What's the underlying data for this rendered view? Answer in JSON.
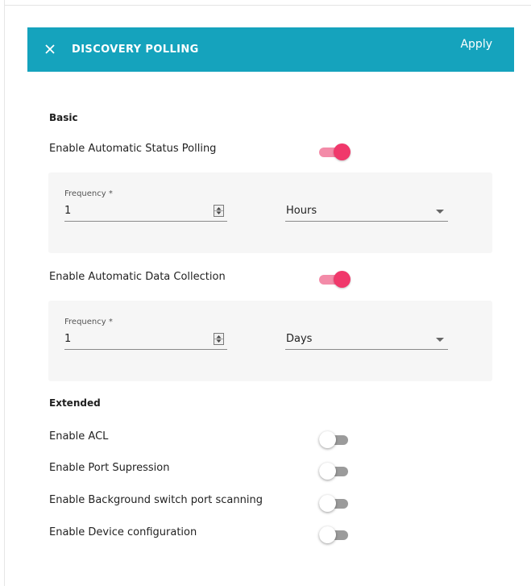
{
  "header": {
    "title": "DISCOVERY POLLING",
    "apply_label": "Apply",
    "close_icon": "close-icon",
    "background_color": "#15a3bd"
  },
  "basic": {
    "title": "Basic",
    "status_polling": {
      "label": "Enable Automatic Status Polling",
      "enabled": true,
      "frequency_label": "Frequency *",
      "frequency_value": "1",
      "unit": "Hours"
    },
    "data_collection": {
      "label": "Enable Automatic Data Collection",
      "enabled": true,
      "frequency_label": "Frequency *",
      "frequency_value": "1",
      "unit": "Days"
    }
  },
  "extended": {
    "title": "Extended",
    "items": [
      {
        "label": "Enable ACL",
        "enabled": false
      },
      {
        "label": "Enable Port Supression",
        "enabled": false
      },
      {
        "label": "Enable Background switch port scanning",
        "enabled": false
      },
      {
        "label": "Enable Device configuration",
        "enabled": false
      }
    ]
  },
  "colors": {
    "toggle_on_thumb": "#f0386b",
    "toggle_on_track": "#f38ba8",
    "toggle_off_track": "#9b9b9b",
    "panel_background": "#f6f6f6"
  }
}
